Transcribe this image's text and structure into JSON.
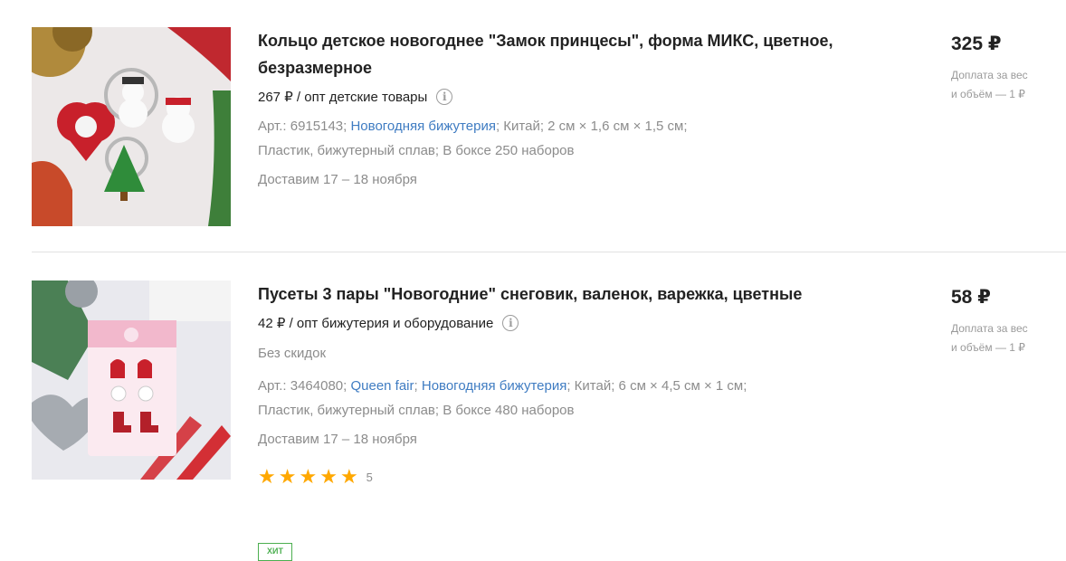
{
  "products": [
    {
      "title_line1": "Кольцо детское новогоднее \"Замок принцесы\", форма МИКС, цветное,",
      "title_line2": "безразмерное",
      "opt_text": "267 ₽ / опт детские товары",
      "info_glyph": "i",
      "meta_art": "Арт.: 6915143;",
      "meta_link1": "Новогодняя бижутерия",
      "meta_rest1": "; Китай; 2 см × 1,6 см × 1,5 см;",
      "meta_line2": "Пластик, бижутерный сплав; В боксе 250 наборов",
      "delivery": "Доставим 17 – 18 ноября",
      "price": "325 ₽",
      "extra_line1": "Доплата за вес",
      "extra_line2": "и объём — 1 ₽"
    },
    {
      "title_line1": "Пусеты 3 пары \"Новогодние\" снеговик, валенок, варежка, цветные",
      "opt_text": "42 ₽ / опт бижутерия и оборудование",
      "info_glyph": "i",
      "no_discount": "Без скидок",
      "meta_art": "Арт.: 3464080;",
      "meta_link1": "Queen fair",
      "meta_sep": ";",
      "meta_link2": "Новогодняя бижутерия",
      "meta_rest1": "; Китай; 6 см × 4,5 см × 1 см;",
      "meta_line2": "Пластик, бижутерный сплав; В боксе 480 наборов",
      "delivery": "Доставим 17 – 18 ноября",
      "rating": 5,
      "rating_text": "5",
      "price": "58 ₽",
      "extra_line1": "Доплата за вес",
      "extra_line2": "и объём — 1 ₽",
      "badge": "ХИТ"
    }
  ],
  "colors": {
    "link": "#3f7cc2",
    "star": "#ffa800",
    "muted": "#8c8c8c",
    "badge": "#4caf50"
  }
}
